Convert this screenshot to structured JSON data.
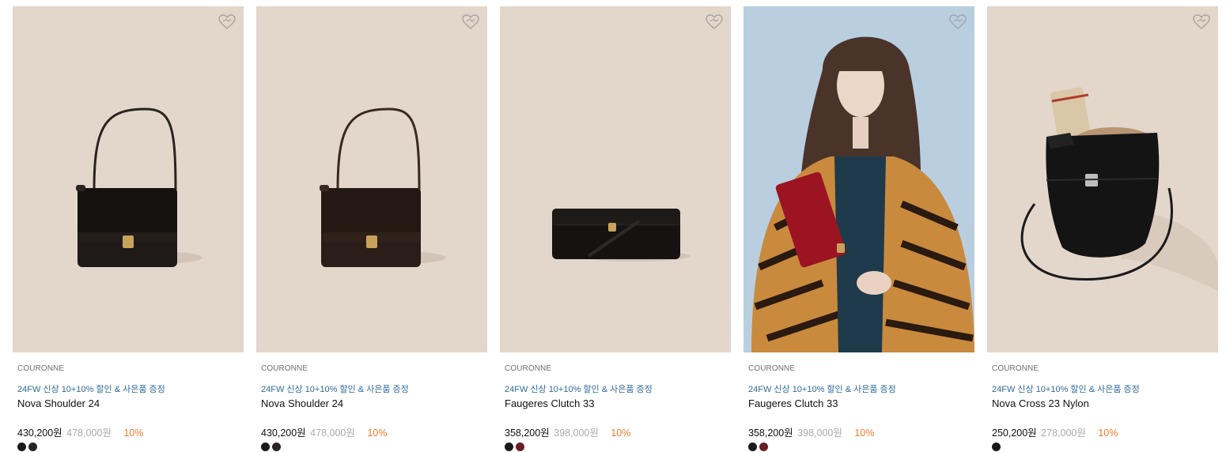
{
  "products": [
    {
      "brand": "COURONNE",
      "promo": "24FW 신상 10+10% 할인 & 사은품 증정",
      "name": "Nova Shoulder 24",
      "price": "430,200원",
      "original_price": "478,000원",
      "discount": "10%",
      "bg_color": "#e3d6cb",
      "swatches": [
        "#1a1a1a",
        "#2a2320"
      ],
      "image": "black-shoulder-bag"
    },
    {
      "brand": "COURONNE",
      "promo": "24FW 신상 10+10% 할인 & 사은품 증정",
      "name": "Nova Shoulder 24",
      "price": "430,200원",
      "original_price": "478,000원",
      "discount": "10%",
      "bg_color": "#e3d6cb",
      "swatches": [
        "#1a1a1a",
        "#2a2320"
      ],
      "image": "brown-shoulder-bag"
    },
    {
      "brand": "COURONNE",
      "promo": "24FW 신상 10+10% 할인 & 사은품 증정",
      "name": "Faugeres Clutch 33",
      "price": "358,200원",
      "original_price": "398,000원",
      "discount": "10%",
      "bg_color": "#e3d6cb",
      "swatches": [
        "#1a1a1a",
        "#6b1d24"
      ],
      "image": "black-clutch"
    },
    {
      "brand": "COURONNE",
      "promo": "24FW 신상 10+10% 할인 & 사은품 증정",
      "name": "Faugeres Clutch 33",
      "price": "358,200원",
      "original_price": "398,000원",
      "discount": "10%",
      "bg_color": "#b9cfe0",
      "swatches": [
        "#1a1a1a",
        "#6b1d24"
      ],
      "image": "model-red-clutch"
    },
    {
      "brand": "COURONNE",
      "promo": "24FW 신상 10+10% 할인 & 사은품 증정",
      "name": "Nova Cross 23 Nylon",
      "price": "250,200원",
      "original_price": "278,000원",
      "discount": "10%",
      "bg_color": "#e3d6cb",
      "swatches": [
        "#1a1a1a"
      ],
      "image": "nylon-cross-bag"
    }
  ],
  "colors": {
    "promo": "#2f6b9a",
    "discount": "#f07b2a",
    "original_price": "#aaaaaa"
  },
  "icons": {
    "wishlist": "heart-icon"
  }
}
